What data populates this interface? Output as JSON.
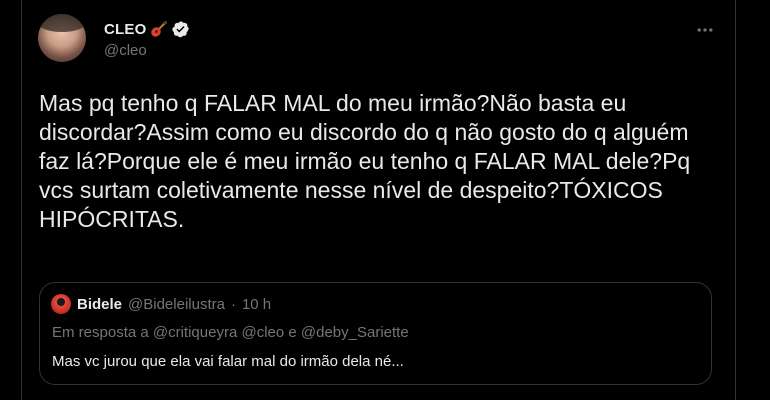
{
  "author": {
    "display_name": "CLEO",
    "name_emoji": "guitar-icon",
    "verified": true,
    "handle": "@cleo"
  },
  "tweet": {
    "text": "Mas pq tenho q FALAR MAL do meu irmão?Não basta eu discordar?Assim como eu discordo do q não gosto do q alguém faz lá?Porque ele é meu irmão eu tenho q FALAR MAL dele?Pq vcs surtam coletivamente nesse nível de despeito?TÓXICOS HIPÓCRITAS."
  },
  "quote": {
    "display_name": "Bidele",
    "handle": "@Bideleilustra",
    "separator": "·",
    "time": "10 h",
    "reply_context": "Em resposta a @critiqueyra @cleo e @deby_Sariette",
    "text": "Mas vc jurou que ela vai falar mal do irmão dela né..."
  },
  "colors": {
    "background": "#000000",
    "text_primary": "#e7e9ea",
    "text_secondary": "#71767b",
    "border": "#2f3336",
    "verified_blue": "#ffffff"
  }
}
